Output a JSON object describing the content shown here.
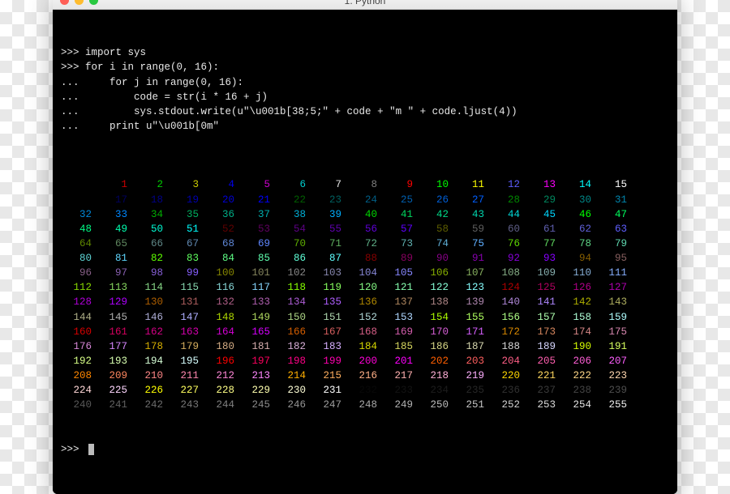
{
  "window": {
    "title": "1. Python"
  },
  "code": [
    ">>> import sys",
    ">>> for i in range(0, 16):",
    "...     for j in range(0, 16):",
    "...         code = str(i * 16 + j)",
    "...         sys.stdout.write(u\"\\u001b[38;5;\" + code + \"m \" + code.ljust(4))",
    "...     print u\"\\u001b[0m\"",
    ""
  ],
  "palette": {
    "base16": [
      "#000000",
      "#cd0000",
      "#00cd00",
      "#cdcd00",
      "#0000ee",
      "#cd00cd",
      "#00cdcd",
      "#e5e5e5",
      "#7f7f7f",
      "#ff0000",
      "#00ff00",
      "#ffff00",
      "#5c5cff",
      "#ff00ff",
      "#00ffff",
      "#ffffff"
    ],
    "cubeSteps": [
      0,
      95,
      135,
      175,
      215,
      255
    ]
  },
  "prompt": ">>>"
}
